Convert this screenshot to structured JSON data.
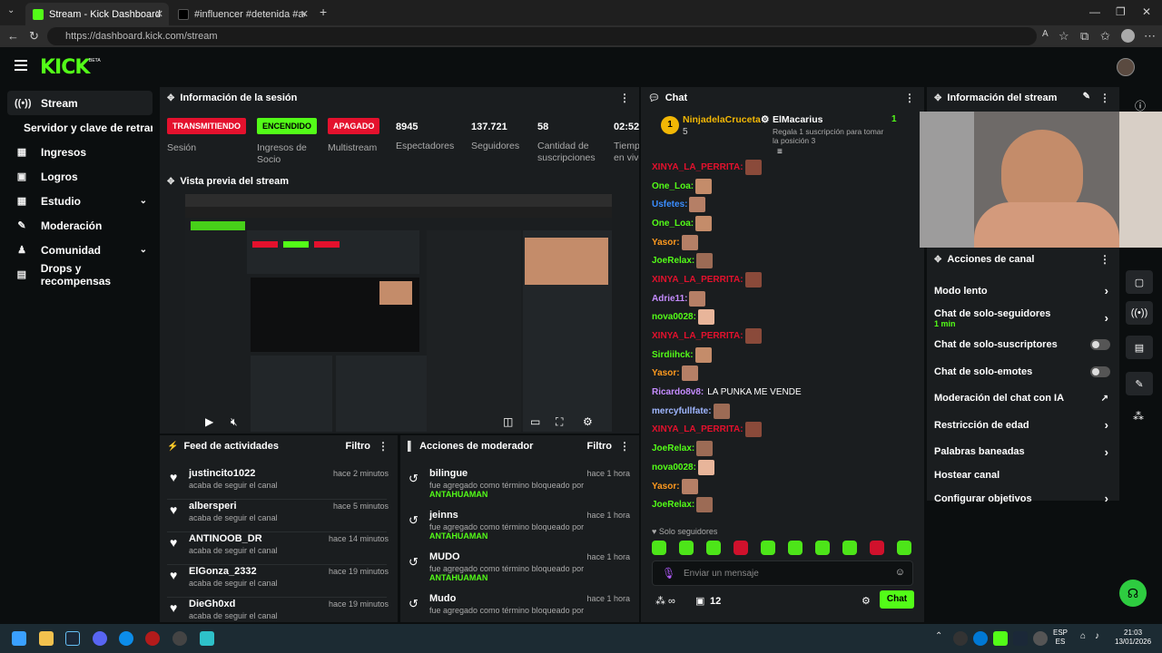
{
  "browser": {
    "tabs": [
      {
        "title": "Stream - Kick Dashboard",
        "active": true
      },
      {
        "title": "#influencer #detenida #aeropuerto",
        "active": false
      }
    ],
    "url": "https://dashboard.kick.com/stream"
  },
  "app": {
    "logo": "KICK",
    "beta": "BETA"
  },
  "sidebar": {
    "items": [
      {
        "label": "Stream",
        "icon": "stream-icon",
        "active": true
      },
      {
        "label": "Servidor y clave de retransmisión",
        "icon": "",
        "sub": true
      },
      {
        "label": "Ingresos",
        "icon": "dollar-icon"
      },
      {
        "label": "Logros",
        "icon": "trophy-icon"
      },
      {
        "label": "Estudio",
        "icon": "grid-icon",
        "chevron": true
      },
      {
        "label": "Moderación",
        "icon": "wrench-icon"
      },
      {
        "label": "Comunidad",
        "icon": "users-icon",
        "chevron": true
      },
      {
        "label": "Drops y recompensas",
        "icon": "gift-icon"
      }
    ]
  },
  "session": {
    "title": "Información de la sesión",
    "cols": [
      {
        "value": "TRANSMITIENDO",
        "kind": "red",
        "label": "Sesión"
      },
      {
        "value": "ENCENDIDO",
        "kind": "green",
        "label": "Ingresos de Socio"
      },
      {
        "value": "APAGADO",
        "kind": "red",
        "label": "Multistream"
      },
      {
        "value": "8945",
        "kind": "num",
        "label": "Espectadores"
      },
      {
        "value": "137.721",
        "kind": "num",
        "label": "Seguidores"
      },
      {
        "value": "58",
        "kind": "num",
        "label": "Cantidad de suscripciones"
      },
      {
        "value": "02:52",
        "kind": "num",
        "label": "Tiempo en vivo"
      }
    ]
  },
  "preview": {
    "title": "Vista previa del stream"
  },
  "feed": {
    "title": "Feed de actividades",
    "filter": "Filtro",
    "items": [
      {
        "name": "justincito1022",
        "sub": "acaba de seguir el canal",
        "time": "hace 2 minutos"
      },
      {
        "name": "albersperi",
        "sub": "acaba de seguir el canal",
        "time": "hace 5 minutos"
      },
      {
        "name": "ANTINOOB_DR",
        "sub": "acaba de seguir el canal",
        "time": "hace 14 minutos"
      },
      {
        "name": "ElGonza_2332",
        "sub": "acaba de seguir el canal",
        "time": "hace 19 minutos"
      },
      {
        "name": "DieGh0xd",
        "sub": "acaba de seguir el canal",
        "time": "hace 19 minutos"
      }
    ]
  },
  "mod_actions": {
    "title": "Acciones de moderador",
    "filter": "Filtro",
    "items": [
      {
        "name": "bilingue",
        "sub": "fue agregado como término bloqueado por",
        "by": "ANTAHUAMAN",
        "time": "hace 1 hora"
      },
      {
        "name": "jeinns",
        "sub": "fue agregado como término bloqueado por",
        "by": "ANTAHUAMAN",
        "time": "hace 1 hora"
      },
      {
        "name": "MUDO",
        "sub": "fue agregado como término bloqueado por",
        "by": "ANTAHUAMAN",
        "time": "hace 1 hora"
      },
      {
        "name": "Mudo",
        "sub": "fue agregado como término bloqueado por",
        "by": "",
        "time": "hace 1 hora"
      }
    ]
  },
  "chat": {
    "title": "Chat",
    "pinned": {
      "user": "NinjadelaCruceta",
      "rank": "1",
      "count": "5",
      "gifter": "ElMacarius",
      "gift_text": "Regala 1 suscripción para tomar la posición 3",
      "gift_count": "1"
    },
    "messages": [
      {
        "user": "XINYA_LA_PERRITA:",
        "color": "#e4112d",
        "emote": "#8a4a3a"
      },
      {
        "user": "One_Loa:",
        "color": "#53fc18",
        "emote": "#c48c6a"
      },
      {
        "user": "Usfetes:",
        "color": "#3a8dff",
        "emote": "#b57f66"
      },
      {
        "user": "One_Loa:",
        "color": "#53fc18",
        "emote": "#c48c6a"
      },
      {
        "user": "Yasor:",
        "color": "#ff9a1f",
        "emote": "#b57f66"
      },
      {
        "user": "JoeRelax:",
        "color": "#53fc18",
        "emote": "#9c6b55"
      },
      {
        "user": "XINYA_LA_PERRITA:",
        "color": "#e4112d",
        "emote": "#8a4a3a"
      },
      {
        "user": "Adrie11:",
        "color": "#c58cff",
        "emote": "#b57f66"
      },
      {
        "user": "nova0028:",
        "color": "#53fc18",
        "emote": "#e8b59a"
      },
      {
        "user": "XINYA_LA_PERRITA:",
        "color": "#e4112d",
        "emote": "#8a4a3a"
      },
      {
        "user": "Sirdiihck:",
        "color": "#53fc18",
        "emote": "#c48c6a"
      },
      {
        "user": "Yasor:",
        "color": "#ff9a1f",
        "emote": "#b57f66"
      },
      {
        "user": "Ricardo8v8:",
        "color": "#c58cff",
        "emote": "",
        "text": "LA PUNKA ME VENDE"
      },
      {
        "user": "mercyfullfate:",
        "color": "#9fb6ff",
        "emote": "#9c6b55"
      },
      {
        "user": "XINYA_LA_PERRITA:",
        "color": "#e4112d",
        "emote": "#8a4a3a"
      },
      {
        "user": "JoeRelax:",
        "color": "#53fc18",
        "emote": "#9c6b55"
      },
      {
        "user": "nova0028:",
        "color": "#53fc18",
        "emote": "#e8b59a"
      },
      {
        "user": "Yasor:",
        "color": "#ff9a1f",
        "emote": "#b57f66"
      },
      {
        "user": "JoeRelax:",
        "color": "#53fc18",
        "emote": "#9c6b55"
      }
    ],
    "mode": "Solo seguidores",
    "input_placeholder": "Enviar un mensaje",
    "send_label": "Chat",
    "viewers_icon_count": "12"
  },
  "stream_info": {
    "title": "Información del stream"
  },
  "channel_actions": {
    "title": "Acciones de canal",
    "items": [
      {
        "label": "Modo lento",
        "type": "chevron"
      },
      {
        "label": "Chat de solo-seguidores",
        "sub": "1 min",
        "type": "chevron"
      },
      {
        "label": "Chat de solo-suscriptores",
        "type": "toggle"
      },
      {
        "label": "Chat de solo-emotes",
        "type": "toggle"
      },
      {
        "label": "Moderación del chat con IA",
        "type": "external"
      },
      {
        "label": "Restricción de edad",
        "type": "chevron"
      },
      {
        "label": "Palabras baneadas",
        "type": "chevron"
      },
      {
        "label": "Hostear canal",
        "type": "none"
      },
      {
        "label": "Configurar objetivos",
        "type": "chevron"
      }
    ]
  },
  "taskbar": {
    "lang": "ESP",
    "lang2": "ES",
    "time": "21:03",
    "date": "13/01/2026"
  },
  "colors": {
    "brand": "#53fc18",
    "live": "#e4112d",
    "panel": "#1a1d1f",
    "bg": "#0b0e0f"
  }
}
